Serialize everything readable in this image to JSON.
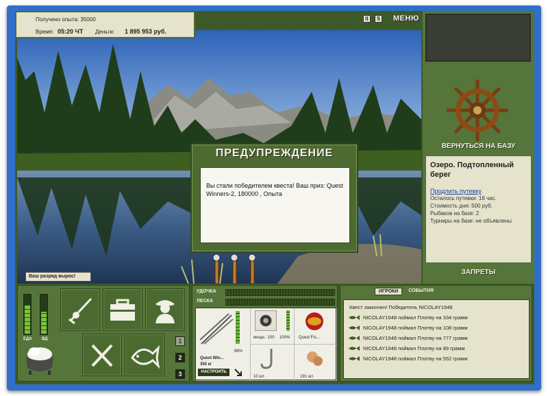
{
  "hud": {
    "experience": "Получено опыта: 35000",
    "time_label": "Время:",
    "time_value": "05:20 ЧТ",
    "money_label": "Деньги:",
    "money_value": "1 895 953 руб.",
    "pause_icon": "II",
    "s_icon": "S",
    "menu_label": "МЕНЮ"
  },
  "notification": "Ваш разряд вырос!",
  "dialog": {
    "title": "ПРЕДУПРЕЖДЕНИЕ",
    "message": "Вы стали победителем квеста! Ваш приз: Quest Winners-2, 180000 , Опыта"
  },
  "right_panel": {
    "return_label": "ВЕРНУТЬСЯ НА БАЗУ",
    "location_title": "Озеро. Подтопленный берег",
    "extend_link": "Продлить путевку",
    "trip_left": "Осталось путевки: 18 час.",
    "day_cost": "Стоимость дня: 500 руб.",
    "anglers": "Рыбаков на базе: 2",
    "tournaments": "Турниры на базе: не объявлены",
    "bans_label": "ЗАПРЕТЫ"
  },
  "status": {
    "food_label": "ЕДА",
    "health_label": "ВД",
    "food_level": 0.72,
    "health_level": 0.55
  },
  "slot_numbers": [
    "1",
    "2",
    "3"
  ],
  "tackle": {
    "rod_label": "УДОЧКА",
    "line_label": "ЛЕСКА",
    "rod_name": "Quest Win...",
    "rod_weight": "355 кг",
    "rod_percent": "96%",
    "reel_power": "мощн.: 100",
    "reel_percent": "100%",
    "lure_name": "Quest Fis...",
    "hooks_count": "10 шт.",
    "bait_count": "191 шт.",
    "setup_button": "НАСТРОИТЬ"
  },
  "events_panel": {
    "tab_players": "ИГРОКИ",
    "tab_events": "СОБЫТИЯ",
    "items": [
      "Квест закончен! Победитель NICOLAY1948",
      "NICOLAY1948 поймал Плотву на 334 грамм",
      "NICOLAY1948 поймал Плотву на 108 грамм",
      "NICOLAY1948 поймал Плотву на 777 грамм",
      "NICOLAY1948 поймал Плотву на 89 грамм",
      "NICOLAY1948 поймал Плотву на 552 грамм"
    ]
  }
}
